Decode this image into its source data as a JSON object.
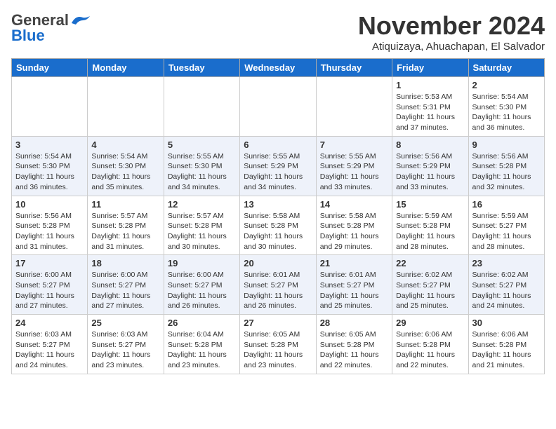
{
  "header": {
    "logo_general": "General",
    "logo_blue": "Blue",
    "month_title": "November 2024",
    "location": "Atiquizaya, Ahuachapan, El Salvador"
  },
  "days_of_week": [
    "Sunday",
    "Monday",
    "Tuesday",
    "Wednesday",
    "Thursday",
    "Friday",
    "Saturday"
  ],
  "weeks": [
    [
      {
        "day": "",
        "info": ""
      },
      {
        "day": "",
        "info": ""
      },
      {
        "day": "",
        "info": ""
      },
      {
        "day": "",
        "info": ""
      },
      {
        "day": "",
        "info": ""
      },
      {
        "day": "1",
        "info": "Sunrise: 5:53 AM\nSunset: 5:31 PM\nDaylight: 11 hours\nand 37 minutes."
      },
      {
        "day": "2",
        "info": "Sunrise: 5:54 AM\nSunset: 5:30 PM\nDaylight: 11 hours\nand 36 minutes."
      }
    ],
    [
      {
        "day": "3",
        "info": "Sunrise: 5:54 AM\nSunset: 5:30 PM\nDaylight: 11 hours\nand 36 minutes."
      },
      {
        "day": "4",
        "info": "Sunrise: 5:54 AM\nSunset: 5:30 PM\nDaylight: 11 hours\nand 35 minutes."
      },
      {
        "day": "5",
        "info": "Sunrise: 5:55 AM\nSunset: 5:30 PM\nDaylight: 11 hours\nand 34 minutes."
      },
      {
        "day": "6",
        "info": "Sunrise: 5:55 AM\nSunset: 5:29 PM\nDaylight: 11 hours\nand 34 minutes."
      },
      {
        "day": "7",
        "info": "Sunrise: 5:55 AM\nSunset: 5:29 PM\nDaylight: 11 hours\nand 33 minutes."
      },
      {
        "day": "8",
        "info": "Sunrise: 5:56 AM\nSunset: 5:29 PM\nDaylight: 11 hours\nand 33 minutes."
      },
      {
        "day": "9",
        "info": "Sunrise: 5:56 AM\nSunset: 5:28 PM\nDaylight: 11 hours\nand 32 minutes."
      }
    ],
    [
      {
        "day": "10",
        "info": "Sunrise: 5:56 AM\nSunset: 5:28 PM\nDaylight: 11 hours\nand 31 minutes."
      },
      {
        "day": "11",
        "info": "Sunrise: 5:57 AM\nSunset: 5:28 PM\nDaylight: 11 hours\nand 31 minutes."
      },
      {
        "day": "12",
        "info": "Sunrise: 5:57 AM\nSunset: 5:28 PM\nDaylight: 11 hours\nand 30 minutes."
      },
      {
        "day": "13",
        "info": "Sunrise: 5:58 AM\nSunset: 5:28 PM\nDaylight: 11 hours\nand 30 minutes."
      },
      {
        "day": "14",
        "info": "Sunrise: 5:58 AM\nSunset: 5:28 PM\nDaylight: 11 hours\nand 29 minutes."
      },
      {
        "day": "15",
        "info": "Sunrise: 5:59 AM\nSunset: 5:28 PM\nDaylight: 11 hours\nand 28 minutes."
      },
      {
        "day": "16",
        "info": "Sunrise: 5:59 AM\nSunset: 5:27 PM\nDaylight: 11 hours\nand 28 minutes."
      }
    ],
    [
      {
        "day": "17",
        "info": "Sunrise: 6:00 AM\nSunset: 5:27 PM\nDaylight: 11 hours\nand 27 minutes."
      },
      {
        "day": "18",
        "info": "Sunrise: 6:00 AM\nSunset: 5:27 PM\nDaylight: 11 hours\nand 27 minutes."
      },
      {
        "day": "19",
        "info": "Sunrise: 6:00 AM\nSunset: 5:27 PM\nDaylight: 11 hours\nand 26 minutes."
      },
      {
        "day": "20",
        "info": "Sunrise: 6:01 AM\nSunset: 5:27 PM\nDaylight: 11 hours\nand 26 minutes."
      },
      {
        "day": "21",
        "info": "Sunrise: 6:01 AM\nSunset: 5:27 PM\nDaylight: 11 hours\nand 25 minutes."
      },
      {
        "day": "22",
        "info": "Sunrise: 6:02 AM\nSunset: 5:27 PM\nDaylight: 11 hours\nand 25 minutes."
      },
      {
        "day": "23",
        "info": "Sunrise: 6:02 AM\nSunset: 5:27 PM\nDaylight: 11 hours\nand 24 minutes."
      }
    ],
    [
      {
        "day": "24",
        "info": "Sunrise: 6:03 AM\nSunset: 5:27 PM\nDaylight: 11 hours\nand 24 minutes."
      },
      {
        "day": "25",
        "info": "Sunrise: 6:03 AM\nSunset: 5:27 PM\nDaylight: 11 hours\nand 23 minutes."
      },
      {
        "day": "26",
        "info": "Sunrise: 6:04 AM\nSunset: 5:28 PM\nDaylight: 11 hours\nand 23 minutes."
      },
      {
        "day": "27",
        "info": "Sunrise: 6:05 AM\nSunset: 5:28 PM\nDaylight: 11 hours\nand 23 minutes."
      },
      {
        "day": "28",
        "info": "Sunrise: 6:05 AM\nSunset: 5:28 PM\nDaylight: 11 hours\nand 22 minutes."
      },
      {
        "day": "29",
        "info": "Sunrise: 6:06 AM\nSunset: 5:28 PM\nDaylight: 11 hours\nand 22 minutes."
      },
      {
        "day": "30",
        "info": "Sunrise: 6:06 AM\nSunset: 5:28 PM\nDaylight: 11 hours\nand 21 minutes."
      }
    ]
  ]
}
